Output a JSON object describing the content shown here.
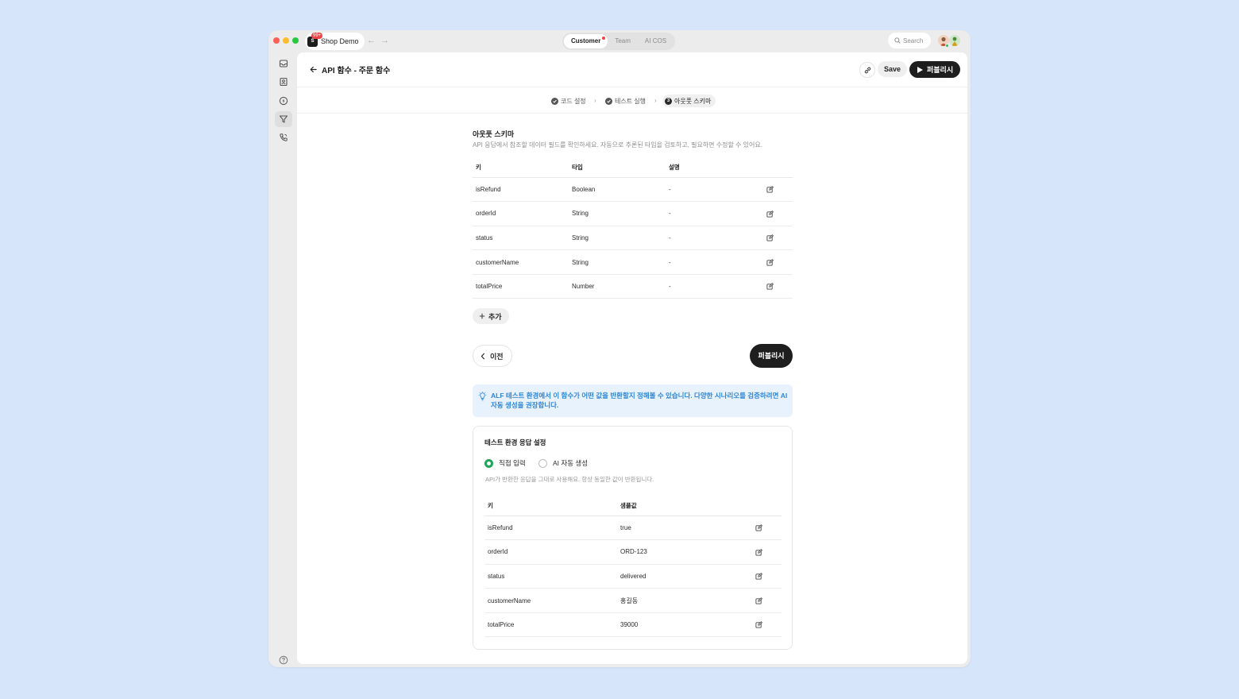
{
  "app": {
    "workspace_name": "Shop Demo",
    "notification_badge": "99+",
    "logo_glyph": "S",
    "tabs": [
      {
        "label": "Customer",
        "active": true,
        "has_dot": true
      },
      {
        "label": "Team",
        "active": false
      },
      {
        "label": "AI COS",
        "active": false
      }
    ],
    "search_label": "Search"
  },
  "sidebar": {
    "items": [
      {
        "name": "inbox-icon"
      },
      {
        "name": "contacts-icon"
      },
      {
        "name": "bolt-icon"
      },
      {
        "name": "funnel-icon",
        "active": true
      },
      {
        "name": "phone-icon"
      }
    ],
    "help_icon": "help-icon"
  },
  "page": {
    "title": "API 함수 - 주문 함수",
    "save_label": "Save",
    "publish_label": "퍼블리시"
  },
  "steps": [
    {
      "label": "코드 설정",
      "state": "done"
    },
    {
      "label": "테스트 실행",
      "state": "done"
    },
    {
      "label": "아웃풋 스키마",
      "state": "active",
      "number": "3"
    }
  ],
  "schema": {
    "title": "아웃풋 스키마",
    "description": "API 응답에서 참조할 데이터 필드를 확인하세요. 자동으로 추론된 타입을 검토하고, 필요하면 수정할 수 있어요.",
    "columns": {
      "key": "키",
      "type": "타입",
      "desc": "설명"
    },
    "rows": [
      {
        "key": "isRefund",
        "type": "Boolean",
        "desc": "-"
      },
      {
        "key": "orderId",
        "type": "String",
        "desc": "-"
      },
      {
        "key": "status",
        "type": "String",
        "desc": "-"
      },
      {
        "key": "customerName",
        "type": "String",
        "desc": "-"
      },
      {
        "key": "totalPrice",
        "type": "Number",
        "desc": "-"
      }
    ],
    "add_label": "추가"
  },
  "navigation": {
    "prev_label": "이전",
    "publish_label": "퍼블리시"
  },
  "info": {
    "text": "ALF 테스트 환경에서 이 함수가 어떤 값을 반환할지 정해볼 수 있습니다. 다양한 시나리오를 검증하려면 AI 자동 생성을 권장합니다."
  },
  "test_response": {
    "title": "테스트 환경 응답 설정",
    "options": [
      {
        "label": "직접 입력",
        "selected": true
      },
      {
        "label": "AI 자동 생성",
        "selected": false
      }
    ],
    "description": "API가 반환한 응답을 그대로 사용해요. 항상 동일한 값이 반환됩니다.",
    "columns": {
      "key": "키",
      "sample": "샘플값"
    },
    "rows": [
      {
        "key": "isRefund",
        "sample": "true"
      },
      {
        "key": "orderId",
        "sample": "ORD-123"
      },
      {
        "key": "status",
        "sample": "delivered"
      },
      {
        "key": "customerName",
        "sample": "홍길동"
      },
      {
        "key": "totalPrice",
        "sample": "39000"
      }
    ]
  },
  "colors": {
    "background": "#d7e5fb",
    "accent_green": "#22a35a",
    "info_blue": "#2f86d6",
    "dark_button": "#1e1e1e"
  }
}
